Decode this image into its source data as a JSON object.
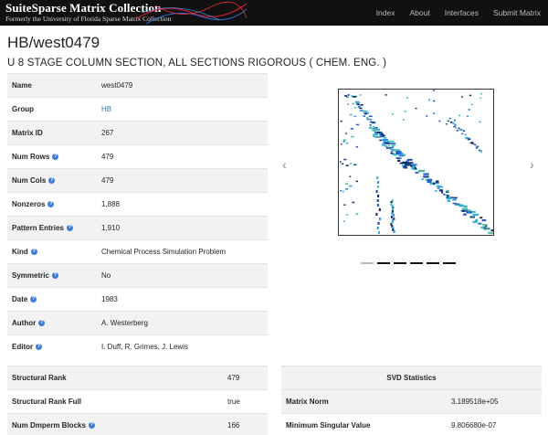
{
  "navbar": {
    "brand_title": "SuiteSparse Matrix Collection",
    "brand_subtitle": "Formerly the University of Florida Sparse Matrix Collection",
    "links": [
      "Index",
      "About",
      "Interfaces",
      "Submit Matrix"
    ]
  },
  "page": {
    "title": "HB/west0479",
    "subtitle": "U 8 STAGE COLUMN SECTION, ALL SECTIONS RIGOROUS ( CHEM. ENG. )"
  },
  "info": {
    "rows": [
      {
        "label": "Name",
        "value": "west0479",
        "help": false,
        "link": false
      },
      {
        "label": "Group",
        "value": "HB",
        "help": false,
        "link": true
      },
      {
        "label": "Matrix ID",
        "value": "267",
        "help": false,
        "link": false
      },
      {
        "label": "Num Rows",
        "value": "479",
        "help": true,
        "link": false
      },
      {
        "label": "Num Cols",
        "value": "479",
        "help": true,
        "link": false
      },
      {
        "label": "Nonzeros",
        "value": "1,888",
        "help": true,
        "link": false
      },
      {
        "label": "Pattern Entries",
        "value": "1,910",
        "help": true,
        "link": false
      },
      {
        "label": "Kind",
        "value": "Chemical Process Simulation Problem",
        "help": true,
        "link": false
      },
      {
        "label": "Symmetric",
        "value": "No",
        "help": true,
        "link": false
      },
      {
        "label": "Date",
        "value": "1983",
        "help": true,
        "link": false
      },
      {
        "label": "Author",
        "value": "A. Westerberg",
        "help": true,
        "link": false
      },
      {
        "label": "Editor",
        "value": "I. Duff, R. Grimes, J. Lewis",
        "help": true,
        "link": false
      }
    ]
  },
  "preview": {
    "prev_icon": "chevron-left-icon",
    "next_icon": "chevron-right-icon",
    "slide_count": 6,
    "active_slide": 0
  },
  "structural": {
    "rows": [
      {
        "label": "Structural Rank",
        "value": "479",
        "help": false
      },
      {
        "label": "Structural Rank Full",
        "value": "true",
        "help": false
      },
      {
        "label": "Num Dmperm Blocks",
        "value": "166",
        "help": true
      }
    ]
  },
  "svd": {
    "header": "SVD Statistics",
    "rows": [
      {
        "label": "Matrix Norm",
        "value": "3.189518e+05"
      },
      {
        "label": "Minimum Singular Value",
        "value": "9.806680e-07"
      }
    ]
  },
  "colors": {
    "navbar_bg": "#111111",
    "link": "#2a7ab0",
    "help_icon": "#3d7dd8",
    "row_stripe": "#f2f2f2"
  }
}
